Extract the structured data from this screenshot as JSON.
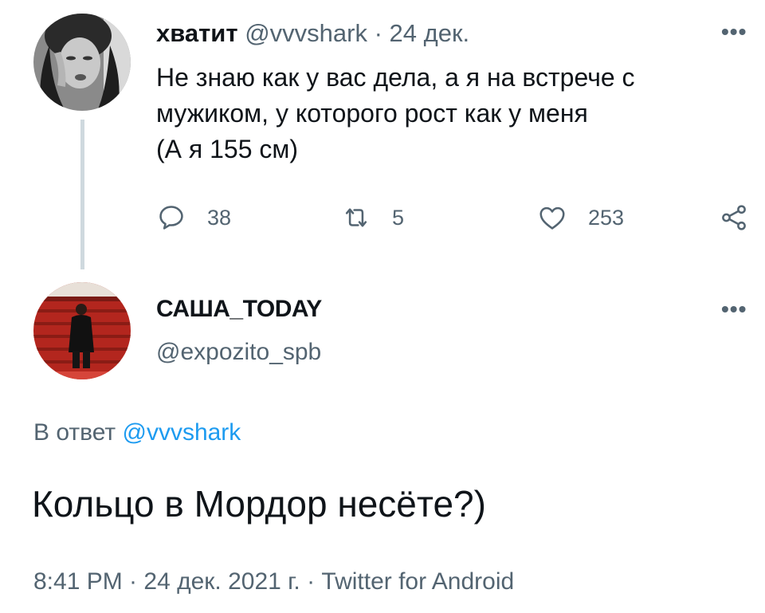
{
  "reply_parent": {
    "display_name": "хватит",
    "handle": "@vvvshark",
    "separator": "·",
    "date": "24 дек.",
    "more_label": "•••",
    "text_lines": [
      "Не знаю как у вас дела, а я на встрече с",
      "мужиком, у которого рост как у меня",
      "(А я 155 см)"
    ],
    "actions": {
      "reply_count": "38",
      "retweet_count": "5",
      "like_count": "253",
      "reply_icon": "reply-icon",
      "retweet_icon": "retweet-icon",
      "like_icon": "heart-icon",
      "share_icon": "share-icon"
    }
  },
  "main_tweet": {
    "display_name": "САША_TODAY",
    "handle": "@expozito_spb",
    "more_label": "•••",
    "reply_prefix": "В ответ",
    "reply_to_handle": "@vvvshark",
    "text": "Кольцо в Мордор несёте?)",
    "meta": "8:41 PM · 24 дек. 2021 г. · Twitter for Android"
  },
  "colors": {
    "text": "#0f1419",
    "muted": "#536471",
    "link": "#1d9bf0",
    "thread_line": "#cfd9de"
  }
}
